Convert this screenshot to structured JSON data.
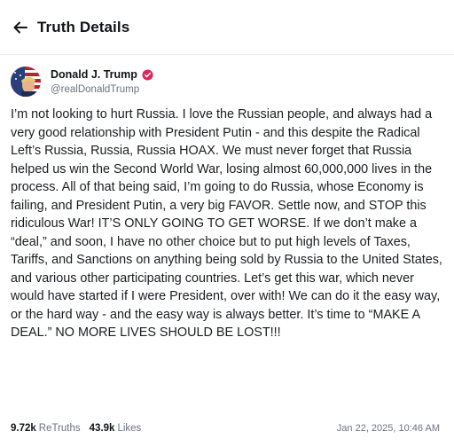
{
  "header": {
    "title": "Truth Details",
    "back_icon": "arrow-left-icon"
  },
  "author": {
    "display_name": "Donald J. Trump",
    "handle": "@realDonaldTrump",
    "verified_icon": "verified-badge-icon",
    "verified_color": "#e0245e"
  },
  "post": {
    "text": "I’m not looking to hurt Russia. I love the Russian people, and always had a very good relationship with President Putin - and this despite the Radical Left’s Russia, Russia, Russia HOAX. We must never forget that Russia helped us win the Second World War, losing almost 60,000,000 lives in the process. All of that being said, I’m going to do Russia, whose Economy is failing, and President Putin, a very big FAVOR. Settle now, and STOP this ridiculous War! IT’S ONLY GOING TO GET WORSE. If we don’t make a “deal,” and soon, I have no other choice but to put high levels of Taxes, Tariffs, and Sanctions on anything being sold by Russia to the United States, and various other participating countries. Let’s get this war, which never would have started if I were President, over with! We can do it the easy way, or the hard way - and the easy way is always better. It’s time to “MAKE A DEAL.” NO MORE LIVES SHOULD BE LOST!!!"
  },
  "stats": {
    "retruths_count": "9.72k",
    "retruths_label": "ReTruths",
    "likes_count": "43.9k",
    "likes_label": "Likes",
    "timestamp": "Jan 22, 2025, 10:46 AM"
  }
}
